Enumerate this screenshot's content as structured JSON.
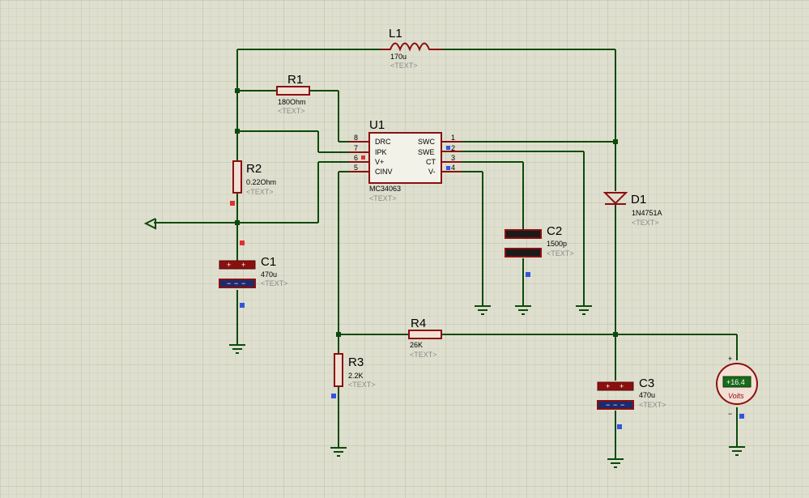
{
  "components": {
    "L1": {
      "ref": "L1",
      "value": "170u",
      "text": "<TEXT>"
    },
    "R1": {
      "ref": "R1",
      "value": "180Ohm",
      "text": "<TEXT>"
    },
    "U1": {
      "ref": "U1",
      "value": "MC34063",
      "text": "<TEXT>",
      "left_pins": [
        {
          "num": "8",
          "name": "DRC"
        },
        {
          "num": "7",
          "name": "IPK"
        },
        {
          "num": "6",
          "name": "V+"
        },
        {
          "num": "5",
          "name": "CINV"
        }
      ],
      "right_pins": [
        {
          "num": "1",
          "name": "SWC"
        },
        {
          "num": "2",
          "name": "SWE"
        },
        {
          "num": "3",
          "name": "CT"
        },
        {
          "num": "4",
          "name": "V-"
        }
      ]
    },
    "R2": {
      "ref": "R2",
      "value": "0.22Ohm",
      "text": "<TEXT>"
    },
    "C1": {
      "ref": "C1",
      "value": "470u",
      "text": "<TEXT>"
    },
    "C2": {
      "ref": "C2",
      "value": "1500p",
      "text": "<TEXT>"
    },
    "D1": {
      "ref": "D1",
      "value": "1N4751A",
      "text": "<TEXT>"
    },
    "R4": {
      "ref": "R4",
      "value": "26K",
      "text": "<TEXT>"
    },
    "R3": {
      "ref": "R3",
      "value": "2.2K",
      "text": "<TEXT>"
    },
    "C3": {
      "ref": "C3",
      "value": "470u",
      "text": "<TEXT>"
    }
  },
  "voltmeter": {
    "reading": "+16.4",
    "label": "Volts",
    "plus": "+",
    "minus": "−"
  },
  "capacitor_marks": {
    "plus": "+",
    "minus": "−"
  },
  "colors": {
    "background": "#dfdfcf",
    "grid_minor": "#cfcfbd",
    "grid_major": "#bcbcaa",
    "wire": "#0b4a0b",
    "component": "#8a1010",
    "ic_fill": "#f2f2e8",
    "capacitor_top": "#8a1010",
    "capacitor_bottom": "#1d2a6e",
    "pin_marker_red": "#e03030",
    "pin_marker_blue": "#3355dd",
    "meter_display": "#1a6b1a"
  }
}
